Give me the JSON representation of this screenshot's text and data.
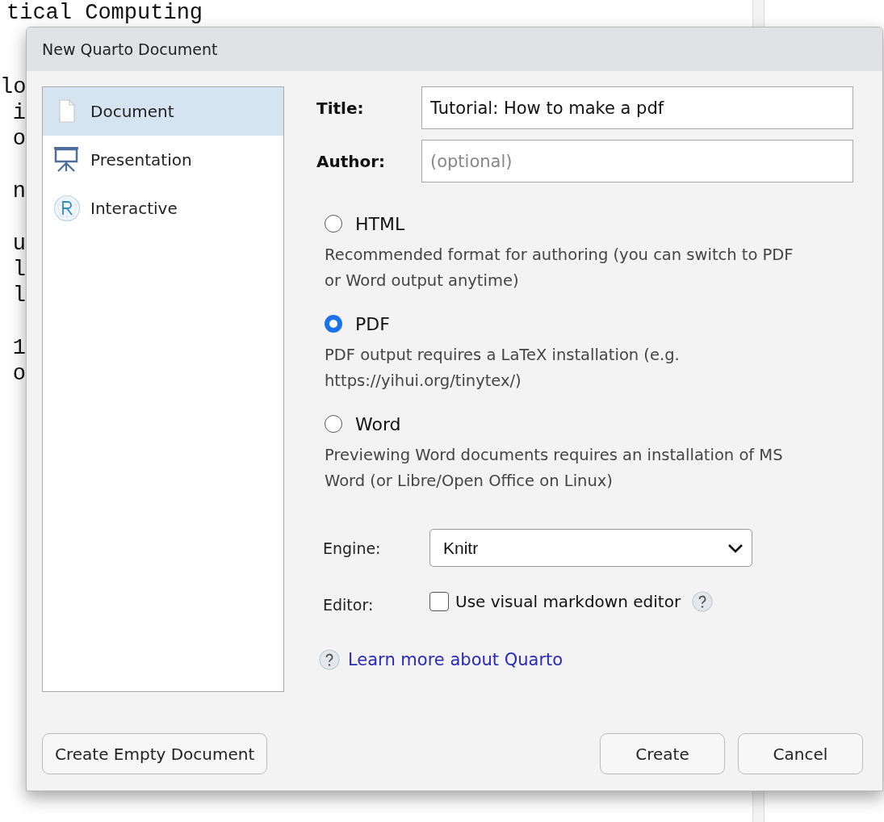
{
  "editor": {
    "top_line": "tical Computing",
    "margin_blocks": [
      {
        "lines": [
          "lo",
          "i",
          "o"
        ]
      },
      {
        "lines": [
          "n"
        ]
      },
      {
        "lines": [
          "u",
          "l",
          "l"
        ]
      },
      {
        "lines": [
          "1",
          "o"
        ]
      }
    ]
  },
  "dialog": {
    "title": "New Quarto Document",
    "sidebar": {
      "items": [
        {
          "label": "Document",
          "kind": "document",
          "selected": true
        },
        {
          "label": "Presentation",
          "kind": "presentation",
          "selected": false
        },
        {
          "label": "Interactive",
          "kind": "r-logo",
          "selected": false
        }
      ]
    },
    "fields": [
      {
        "label": "Title:",
        "value": "Tutorial: How to make a pdf"
      },
      {
        "label": "Author:",
        "placeholder": "(optional)"
      }
    ],
    "formats": [
      {
        "label": "HTML",
        "selected": false,
        "description": "Recommended format for authoring (you can switch to PDF or Word output anytime)"
      },
      {
        "label": "PDF",
        "selected": true,
        "description": "PDF output requires a LaTeX installation (e.g. https://yihui.org/tinytex/)"
      },
      {
        "label": "Word",
        "selected": false,
        "description": "Previewing Word documents requires an installation of MS Word (or Libre/Open Office on Linux)"
      }
    ],
    "engine": {
      "label": "Engine:",
      "value": "Knitr"
    },
    "editor_option": {
      "label": "Editor:",
      "checkbox_label": "Use visual markdown editor",
      "checked": false
    },
    "learn_more": "Learn more about Quarto",
    "buttons": [
      {
        "label": "Create Empty Document",
        "kind": "secondary"
      },
      {
        "label": "Create",
        "kind": "primary"
      },
      {
        "label": "Cancel",
        "kind": "primary"
      }
    ]
  }
}
